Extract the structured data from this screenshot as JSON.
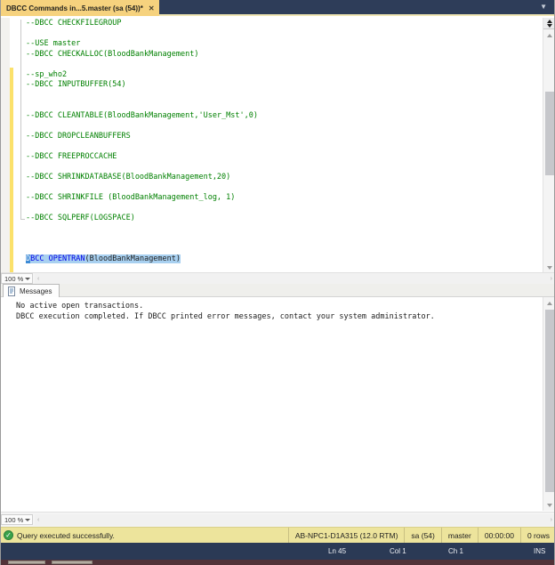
{
  "window": {
    "tab_title": "DBCC Commands in...5.master (sa (54))*",
    "close_glyph": "✕",
    "tab_overflow_glyph": "▼"
  },
  "editor": {
    "zoom_level": "100 %",
    "lines": [
      "--DBCC CHECKFILEGROUP",
      "",
      "--USE master",
      "--DBCC CHECKALLOC(BloodBankManagement)",
      "",
      "--sp_who2",
      "--DBCC INPUTBUFFER(54)",
      "",
      "",
      "--DBCC CLEANTABLE(BloodBankManagement,'User_Mst',0)",
      "",
      "--DBCC DROPCLEANBUFFERS",
      "",
      "--DBCC FREEPROCCACHE",
      "",
      "--DBCC SHRINKDATABASE(BloodBankManagement,20)",
      "",
      "--DBCC SHRINKFILE (BloodBankManagement_log, 1)",
      "",
      "--DBCC SQLPERF(LOGSPACE)",
      "",
      "",
      ""
    ],
    "selected_segments": [
      {
        "text": "D",
        "style": "caret"
      },
      {
        "text": "BCC OPENTRAN",
        "style": "keyword"
      },
      {
        "text": "(BloodBankManagement)",
        "style": "plain"
      }
    ]
  },
  "results": {
    "tab_label": "Messages",
    "zoom_level": "100 %",
    "messages": [
      "No active open transactions.",
      "DBCC execution completed. If DBCC printed error messages, contact your system administrator."
    ]
  },
  "status_bar": {
    "message": "Query executed successfully.",
    "check_glyph": "✓",
    "server": "AB-NPC1-D1A315 (12.0 RTM)",
    "user": "sa (54)",
    "database": "master",
    "duration": "00:00:00",
    "rows": "0 rows"
  },
  "bottom_bar": {
    "line": "Ln 45",
    "column": "Col 1",
    "char": "Ch 1",
    "mode": "INS"
  },
  "colors": {
    "tab_strip_navy": "#2e3d59",
    "active_tab_gold": "#f6d27e",
    "status_bar_yellow": "#ede49c",
    "bottom_bar_navy": "#2b3a55",
    "comment_green": "#008000",
    "keyword_blue": "#0000e8",
    "selection_blue": "#a8d0f0",
    "change_bar_yellow": "#fbe16b",
    "success_green": "#39a24a"
  }
}
